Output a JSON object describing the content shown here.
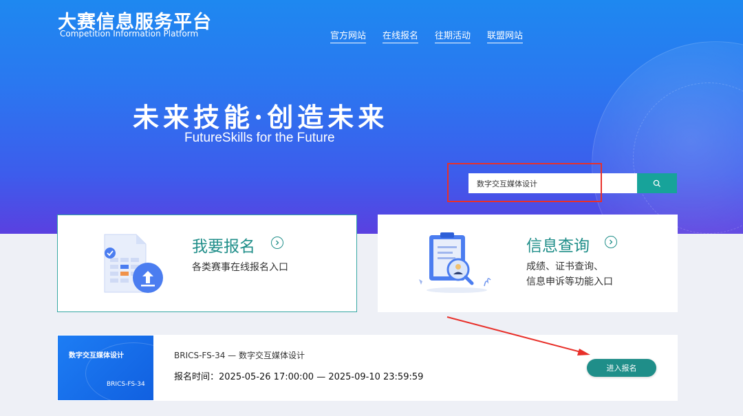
{
  "header": {
    "logo_title": "大赛信息服务平台",
    "logo_subtitle": "Competition Information Platform",
    "nav": [
      "官方网站",
      "在线报名",
      "往期活动",
      "联盟网站"
    ]
  },
  "hero": {
    "slogan_cn": "未来技能·创造未来",
    "slogan_en": "FutureSkills  for the Future"
  },
  "search": {
    "value": "数字交互媒体设计",
    "button_icon": "search-icon"
  },
  "cards": {
    "register": {
      "title": "我要报名",
      "desc": "各类赛事在线报名入口",
      "icon": "form-upload-icon"
    },
    "query": {
      "title": "信息查询",
      "desc_line1": "成绩、证书查询、",
      "desc_line2": "信息申诉等功能入口",
      "icon": "document-search-icon"
    }
  },
  "competition": {
    "thumb_title": "数字交互媒体设计",
    "thumb_code": "BRICS-FS-34",
    "name": "BRICS-FS-34 — 数字交互媒体设计",
    "time": "报名时间：2025-05-26 17:00:00 — 2025-09-10 23:59:59",
    "button": "进入报名"
  },
  "colors": {
    "accent": "#1f8e89",
    "annotation": "#e8302a"
  }
}
